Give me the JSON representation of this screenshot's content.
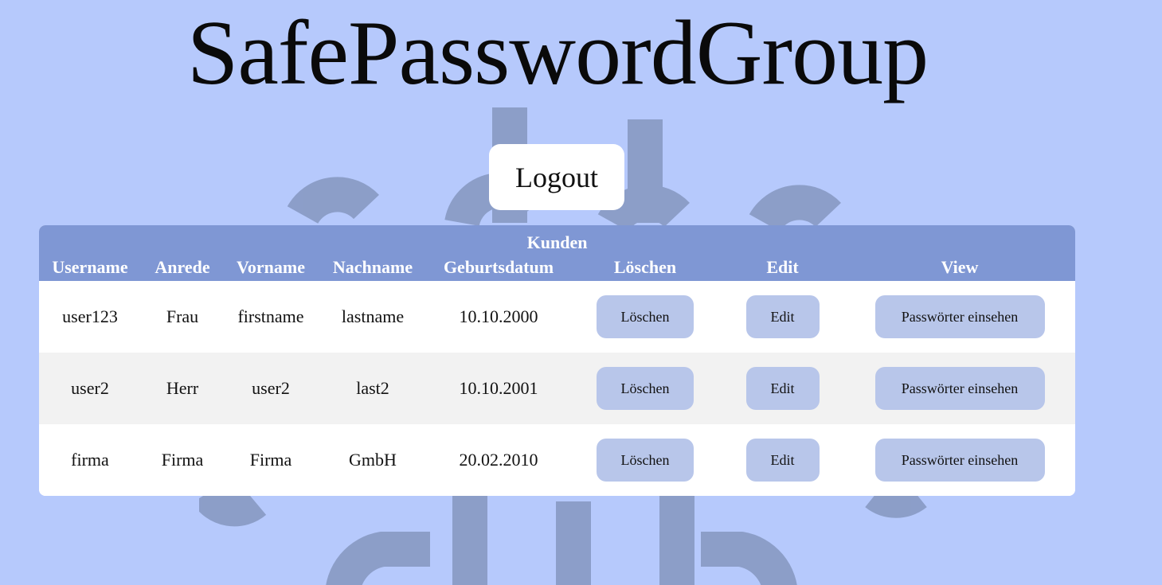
{
  "header": {
    "title": "SafePasswordGroup",
    "logout_label": "Logout"
  },
  "table": {
    "caption": "Kunden",
    "columns": [
      "Username",
      "Anrede",
      "Vorname",
      "Nachname",
      "Geburtsdatum",
      "Löschen",
      "Edit",
      "View"
    ],
    "rows": [
      {
        "username": "user123",
        "anrede": "Frau",
        "vorname": "firstname",
        "nachname": "lastname",
        "geburtsdatum": "10.10.2000",
        "delete_label": "Löschen",
        "edit_label": "Edit",
        "view_label": "Passwörter einsehen"
      },
      {
        "username": "user2",
        "anrede": "Herr",
        "vorname": "user2",
        "nachname": "last2",
        "geburtsdatum": "10.10.2001",
        "delete_label": "Löschen",
        "edit_label": "Edit",
        "view_label": "Passwörter einsehen"
      },
      {
        "username": "firma",
        "anrede": "Firma",
        "vorname": "Firma",
        "nachname": "GmbH",
        "geburtsdatum": "20.02.2010",
        "delete_label": "Löschen",
        "edit_label": "Edit",
        "view_label": "Passwörter einsehen"
      }
    ]
  },
  "colors": {
    "background": "#b6c9fc",
    "table_header": "#7f97d4",
    "button": "#b8c6ea",
    "row_alt": "#f2f2f2"
  },
  "icons": {
    "background_logo": "circuit-lock-logo"
  }
}
